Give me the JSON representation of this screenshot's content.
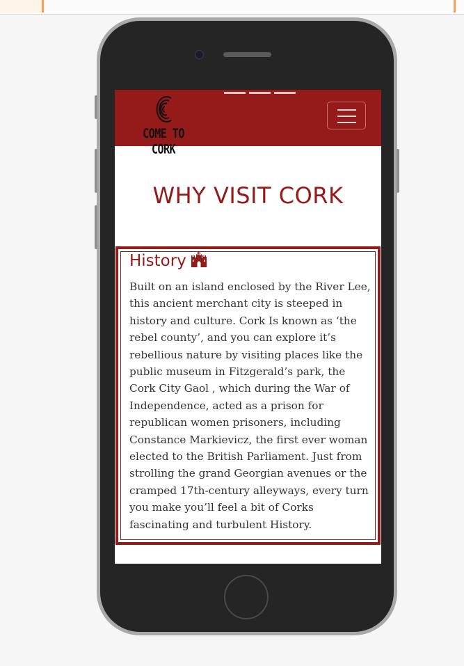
{
  "navbar": {
    "brand_text": "COME TO CORK",
    "menu_toggle_label": "Toggle navigation"
  },
  "page": {
    "title": "WHY VISIT CORK"
  },
  "history_card": {
    "heading": "History",
    "icon": "castle-icon",
    "body": "Built on an island enclosed by the River Lee, this ancient merchant city is steeped in history and culture. Cork Is known as ‘the rebel county’, and you can explore it’s rebellious nature by visiting places like the public museum in Fitzgerald’s park, the Cork City Gaol , which during the War of Independence, acted as a prison for republican women prisoners, including Constance Markievicz, the first ever woman elected to the British Parliament. Just from strolling the grand Georgian avenues or the cramped 17th-century alleyways, every turn you make you’ll feel a bit of Corks fascinating and turbulent History."
  },
  "colors": {
    "brand": "#951b1b",
    "background": "#f6f6f6",
    "phone_body": "#252525"
  }
}
